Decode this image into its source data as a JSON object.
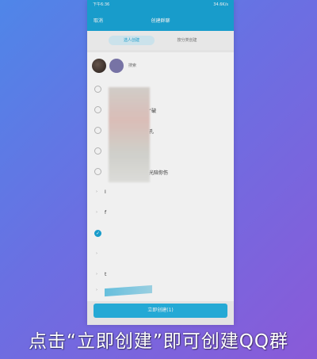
{
  "statusbar": {
    "time": "下午6:36",
    "net": "34.6K/s"
  },
  "titlebar": {
    "cancel_label": "取消",
    "title": "创建群聊"
  },
  "tabs": [
    {
      "label": "选人创建",
      "active": true
    },
    {
      "label": "按分类创建",
      "active": false
    }
  ],
  "search": {
    "placeholder": "搜索"
  },
  "contact_rows": [
    {
      "text": ""
    },
    {
      "text": "”破"
    },
    {
      "text": "孔"
    },
    {
      "text": ""
    },
    {
      "text": "光陪你伤"
    }
  ],
  "group_rows": [
    {
      "text": "I"
    },
    {
      "text": "f"
    },
    {
      "text": ""
    },
    {
      "text": ""
    },
    {
      "text": "t"
    },
    {
      "text": ""
    },
    {
      "text": ""
    }
  ],
  "create_button_label": "立即创建(1)",
  "caption": "点击“立即创建”即可创建QQ群",
  "colors": {
    "accent": "#1aa6d8",
    "button": "#27b4e3",
    "background_gradient_start": "#4f86e8",
    "background_gradient_end": "#8a5ad8"
  },
  "icons": {
    "checked_radio": "check-icon",
    "group_expand": "chevron-right-icon"
  }
}
